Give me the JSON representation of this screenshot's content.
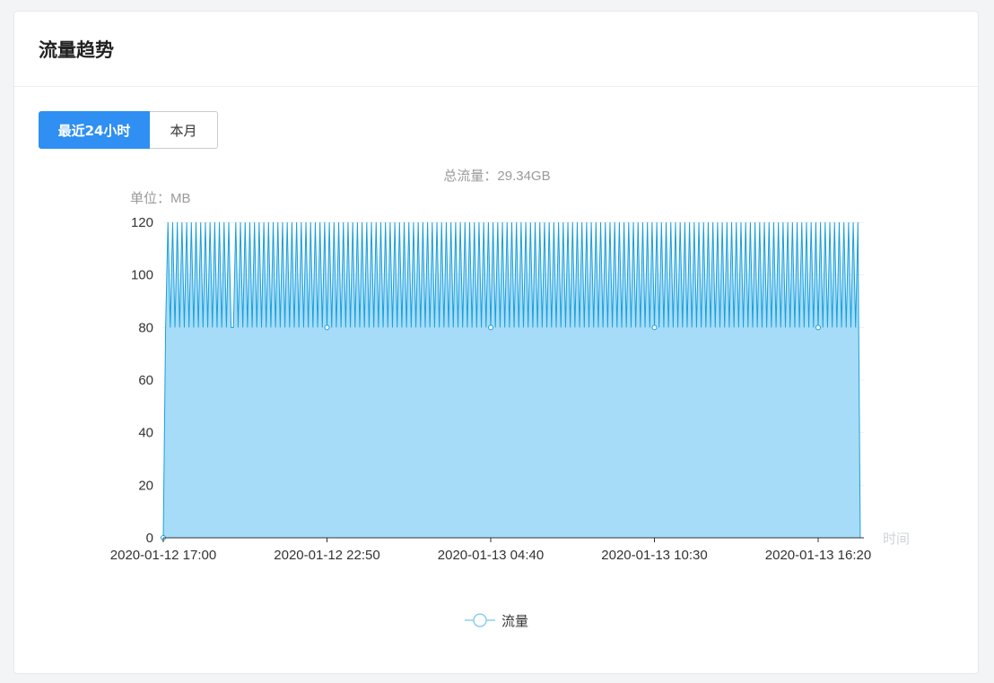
{
  "header": {
    "title": "流量趋势"
  },
  "tabs": [
    {
      "label": "最近24小时",
      "active": true
    },
    {
      "label": "本月",
      "active": false
    }
  ],
  "chart_data": {
    "type": "area",
    "subtitle": "总流量：29.34GB",
    "unit_label": "单位：MB",
    "xlabel": "时间",
    "ylim": [
      0,
      120
    ],
    "yticks": [
      0,
      20,
      40,
      60,
      80,
      100,
      120
    ],
    "x_tick_labels": [
      "2020-01-12 17:00",
      "2020-01-12 22:50",
      "2020-01-13 04:40",
      "2020-01-13 10:30",
      "2020-01-13 16:20"
    ],
    "grid": true,
    "legend_position": "bottom",
    "colors": {
      "line": "#1a9fdc",
      "fill": "#a6dcf7",
      "accent": "#2f8ff2"
    },
    "series": [
      {
        "name": "流量",
        "sampling_interval_minutes": 5,
        "start": "2020-01-12 17:00",
        "end": "2020-01-13 17:15",
        "pattern_values": [
          80,
          120
        ],
        "values": [
          0,
          80,
          120,
          80,
          120,
          80,
          120,
          80,
          120,
          80,
          120,
          80,
          120,
          80,
          120,
          80,
          120,
          80,
          120,
          80,
          120,
          80,
          120,
          80,
          120,
          80,
          120,
          80,
          120,
          80,
          80,
          120,
          80,
          120,
          80,
          120,
          80,
          120,
          80,
          120,
          80,
          120,
          80,
          120,
          80,
          120,
          80,
          120,
          80,
          120,
          80,
          120,
          80,
          120,
          80,
          120,
          80,
          120,
          80,
          120,
          80,
          120,
          80,
          120,
          80,
          120,
          80,
          120,
          80,
          120,
          80,
          120,
          80,
          120,
          80,
          120,
          80,
          120,
          80,
          120,
          80,
          120,
          80,
          120,
          80,
          120,
          80,
          120,
          80,
          120,
          80,
          120,
          80,
          120,
          80,
          120,
          80,
          120,
          80,
          120,
          80,
          120,
          80,
          120,
          80,
          120,
          80,
          120,
          80,
          120,
          80,
          120,
          80,
          120,
          80,
          120,
          80,
          120,
          80,
          120,
          80,
          120,
          80,
          120,
          80,
          120,
          80,
          120,
          80,
          120,
          80,
          120,
          80,
          120,
          80,
          120,
          80,
          120,
          80,
          120,
          80,
          120,
          80,
          120,
          80,
          120,
          80,
          120,
          80,
          120,
          80,
          120,
          80,
          120,
          80,
          120,
          80,
          120,
          80,
          120,
          80,
          120,
          80,
          120,
          80,
          120,
          80,
          120,
          80,
          120,
          80,
          120,
          80,
          120,
          80,
          120,
          80,
          120,
          80,
          120,
          80,
          120,
          80,
          120,
          80,
          120,
          80,
          120,
          80,
          120,
          80,
          120,
          80,
          120,
          80,
          120,
          80,
          120,
          80,
          120,
          80,
          120,
          80,
          120,
          80,
          120,
          80,
          120,
          80,
          120,
          80,
          120,
          80,
          120,
          80,
          120,
          80,
          120,
          80,
          120,
          80,
          120,
          80,
          120,
          80,
          120,
          80,
          120,
          80,
          120,
          80,
          120,
          80,
          120,
          80,
          120,
          80,
          120,
          80,
          120,
          80,
          120,
          80,
          120,
          80,
          120,
          80,
          120,
          80,
          120,
          80,
          120,
          80,
          120,
          80,
          120,
          80,
          120,
          80,
          120,
          80,
          120,
          80,
          120,
          80,
          120,
          80,
          120,
          80,
          120,
          80,
          120,
          80,
          120,
          80,
          120,
          80,
          120,
          80,
          120,
          80,
          120,
          80,
          120,
          80,
          120,
          80,
          120,
          80,
          120,
          80,
          120,
          80,
          120,
          80,
          120,
          80,
          120,
          0,
          0
        ]
      }
    ]
  }
}
